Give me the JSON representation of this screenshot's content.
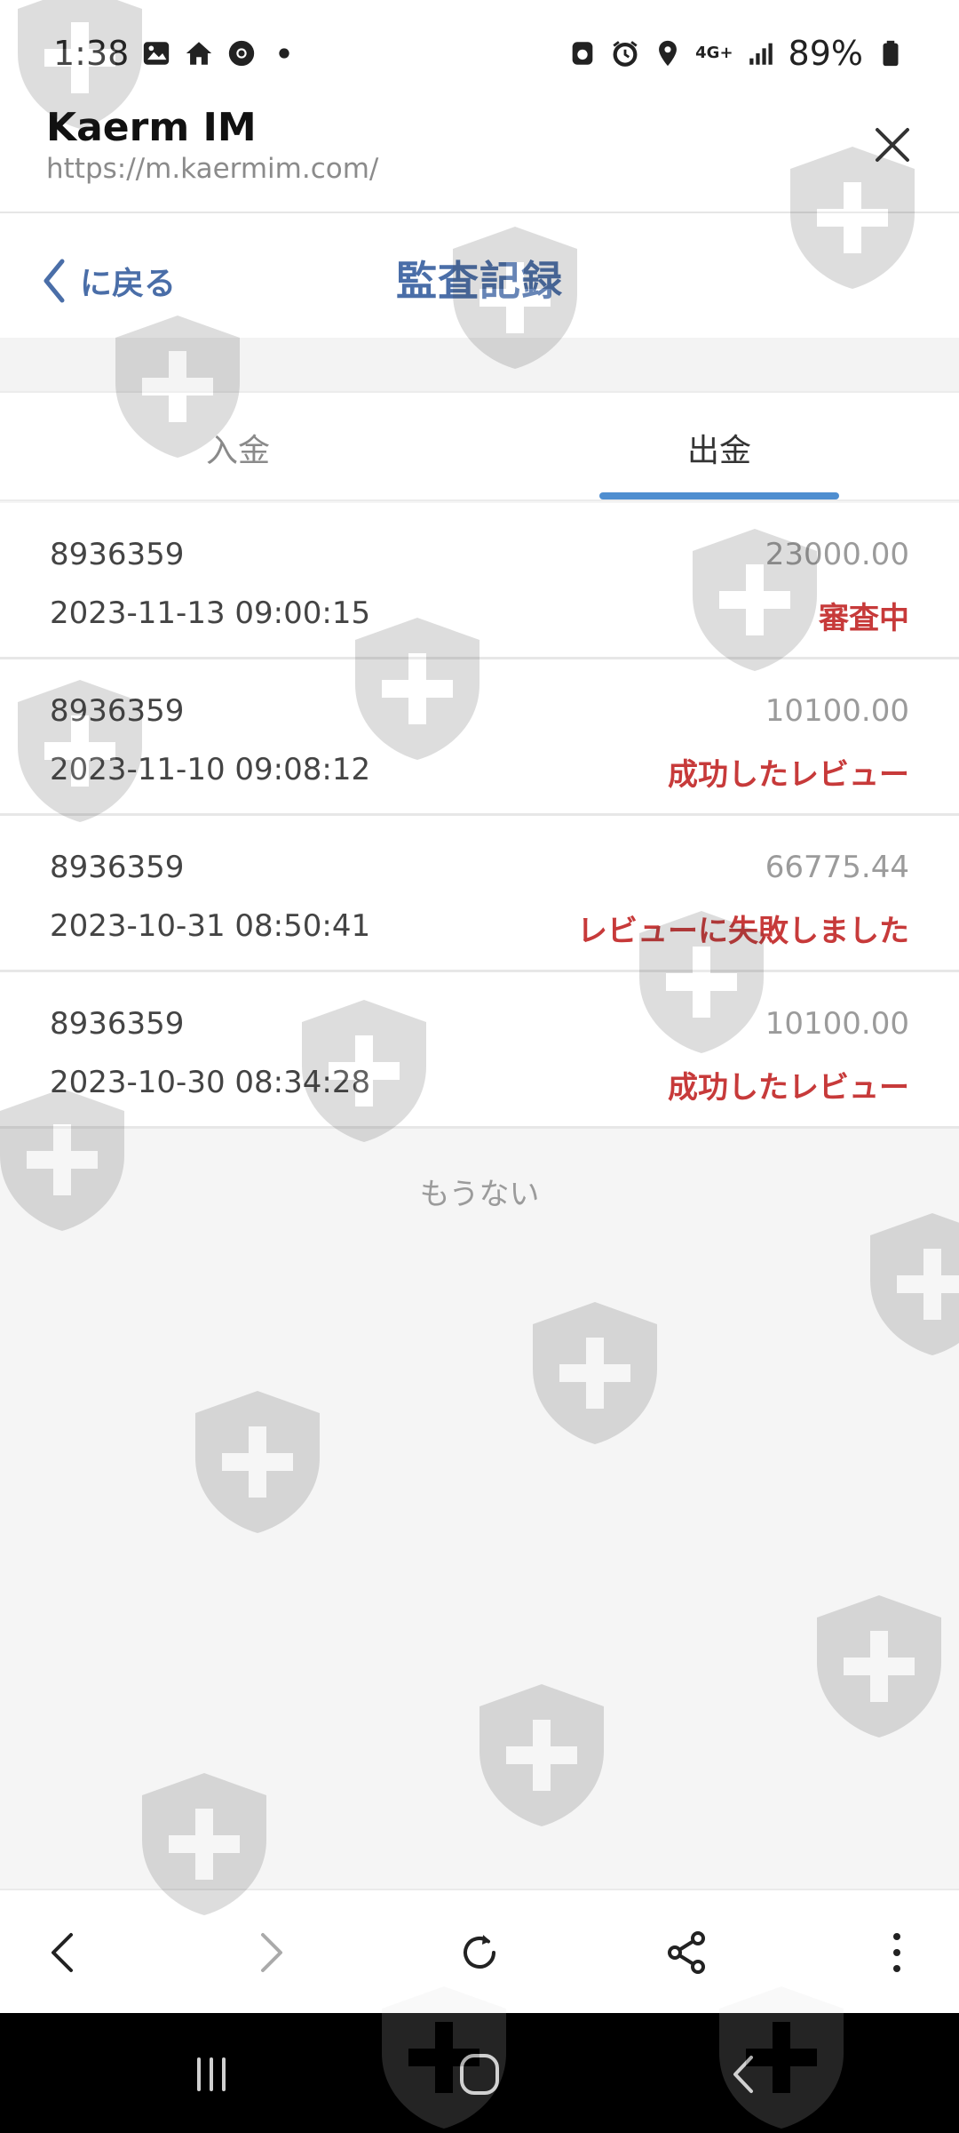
{
  "status_bar": {
    "time": "1:38",
    "battery": "89%",
    "network": "4G+",
    "left_icons": [
      "photo-icon",
      "home-icon",
      "chrome-icon",
      "dot-icon"
    ],
    "right_icons": [
      "cleaner-icon",
      "alarm-icon",
      "location-icon",
      "signal-icon",
      "battery-icon"
    ]
  },
  "browser": {
    "site_title": "Kaerm IM",
    "url": "https://m.kaermim.com/"
  },
  "page": {
    "back_label": "に戻る",
    "title": "監査記録"
  },
  "tabs": [
    {
      "label": "入金",
      "active": false
    },
    {
      "label": "出金",
      "active": true
    }
  ],
  "records": [
    {
      "id": "8936359",
      "date": "2023-11-13 09:00:15",
      "amount": "23000.00",
      "status": "審査中"
    },
    {
      "id": "8936359",
      "date": "2023-11-10 09:08:12",
      "amount": "10100.00",
      "status": "成功したレビュー"
    },
    {
      "id": "8936359",
      "date": "2023-10-31 08:50:41",
      "amount": "66775.44",
      "status": "レビューに失敗しました"
    },
    {
      "id": "8936359",
      "date": "2023-10-30 08:34:28",
      "amount": "10100.00",
      "status": "成功したレビュー"
    }
  ],
  "no_more_text": "もうない",
  "colors": {
    "accent": "#4a6ea8",
    "tab_underline": "#4f8ed0",
    "status_red": "#c73a3a",
    "amount_gray": "#9b9b9b",
    "background": "#f5f5f5"
  }
}
